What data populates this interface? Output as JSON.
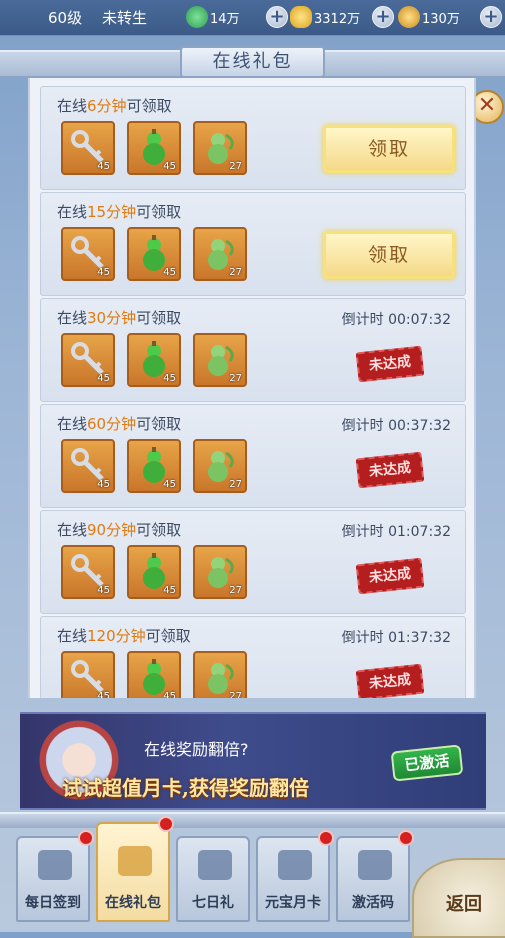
{
  "topbar": {
    "level": "60级",
    "rebirth": "未转生",
    "resources": [
      {
        "icon": "stamina-icon",
        "value": "14万",
        "color": "#3fbf6a"
      },
      {
        "icon": "gold-ingot-icon",
        "value": "3312万",
        "color": "#f2c13a"
      },
      {
        "icon": "coin-icon",
        "value": "130万",
        "color": "#e8b030"
      }
    ]
  },
  "panel": {
    "title": "在线礼包",
    "claim_label": "领取",
    "countdown_prefix": "倒计时",
    "not_reached_label": "未达成",
    "title_prefix": "在线",
    "title_suffix": "可领取",
    "rows": [
      {
        "minutes": "6分钟",
        "countdown": "",
        "state": "claim",
        "items": [
          {
            "icon": "key-icon",
            "qty": "45"
          },
          {
            "icon": "gourd-icon",
            "qty": "45"
          },
          {
            "icon": "jade-gourd-icon",
            "qty": "27"
          }
        ]
      },
      {
        "minutes": "15分钟",
        "countdown": "",
        "state": "claim",
        "items": [
          {
            "icon": "key-icon",
            "qty": "45"
          },
          {
            "icon": "gourd-icon",
            "qty": "45"
          },
          {
            "icon": "jade-gourd-icon",
            "qty": "27"
          }
        ]
      },
      {
        "minutes": "30分钟",
        "countdown": "00:07:32",
        "state": "locked",
        "items": [
          {
            "icon": "key-icon",
            "qty": "45"
          },
          {
            "icon": "gourd-icon",
            "qty": "45"
          },
          {
            "icon": "jade-gourd-icon",
            "qty": "27"
          }
        ]
      },
      {
        "minutes": "60分钟",
        "countdown": "00:37:32",
        "state": "locked",
        "items": [
          {
            "icon": "key-icon",
            "qty": "45"
          },
          {
            "icon": "gourd-icon",
            "qty": "45"
          },
          {
            "icon": "jade-gourd-icon",
            "qty": "27"
          }
        ]
      },
      {
        "minutes": "90分钟",
        "countdown": "01:07:32",
        "state": "locked",
        "items": [
          {
            "icon": "key-icon",
            "qty": "45"
          },
          {
            "icon": "gourd-icon",
            "qty": "45"
          },
          {
            "icon": "jade-gourd-icon",
            "qty": "27"
          }
        ]
      },
      {
        "minutes": "120分钟",
        "countdown": "01:37:32",
        "state": "locked",
        "items": [
          {
            "icon": "key-icon",
            "qty": "45"
          },
          {
            "icon": "gourd-icon",
            "qty": "45"
          },
          {
            "icon": "jade-gourd-icon",
            "qty": "27"
          }
        ]
      }
    ]
  },
  "banner": {
    "question": "在线奖励翻倍?",
    "promo": "试试超值月卡,获得奖励翻倍",
    "activated": "已激活"
  },
  "tabs": [
    {
      "label": "每日签到",
      "icon": "scroll-icon",
      "dot": true,
      "active": false
    },
    {
      "label": "在线礼包",
      "icon": "gift-icon",
      "dot": true,
      "active": true
    },
    {
      "label": "七日礼",
      "icon": "cloud-emblem-icon",
      "dot": false,
      "active": false
    },
    {
      "label": "元宝月卡",
      "icon": "card-icon",
      "dot": true,
      "active": false
    },
    {
      "label": "激活码",
      "icon": "code-icon",
      "dot": true,
      "active": false
    }
  ],
  "back_label": "返回"
}
